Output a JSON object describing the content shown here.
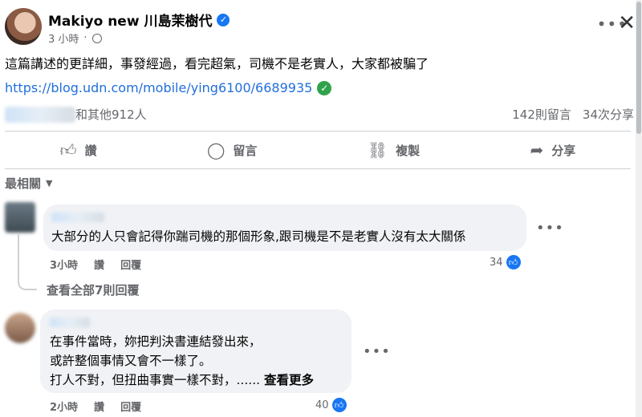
{
  "post": {
    "author": "Makiyo new 川島茉樹代",
    "time": "3 小時",
    "text": "這篇講述的更詳細，事發經過，看完超氣，司機不是老實人，大家都被騙了",
    "link": "https://blog.udn.com/mobile/ying6100/6689935",
    "reactions_text": "和其他912人",
    "comments_count": "142則留言",
    "shares_count": "34次分享"
  },
  "actions": {
    "like": "讚",
    "comment": "留言",
    "copy": "複製",
    "share": "分享"
  },
  "sort_label": "最相關",
  "comments": [
    {
      "text": "大部分的人只會記得你踹司機的那個形象,跟司機是不是老實人沒有太大關係",
      "time": "3小時",
      "like": "讚",
      "reply": "回覆",
      "likes": "34",
      "view_replies": "查看全部7則回覆"
    },
    {
      "line1": "在事件當時，妳把判決書連結發出來，",
      "line2": "或許整個事情又會不一樣了。",
      "line3": "打人不對，但扭曲事實一樣不對，......",
      "see_more": "查看更多",
      "time": "2小時",
      "like": "讚",
      "reply": "回覆",
      "likes": "40"
    }
  ],
  "icons": {
    "verified": "verified-badge-icon",
    "globe": "globe-icon",
    "more": "more-options-icon",
    "close": "close-icon"
  },
  "colors": {
    "link": "#216fdb",
    "accent": "#1877f2",
    "verified_link": "#31a24c"
  }
}
